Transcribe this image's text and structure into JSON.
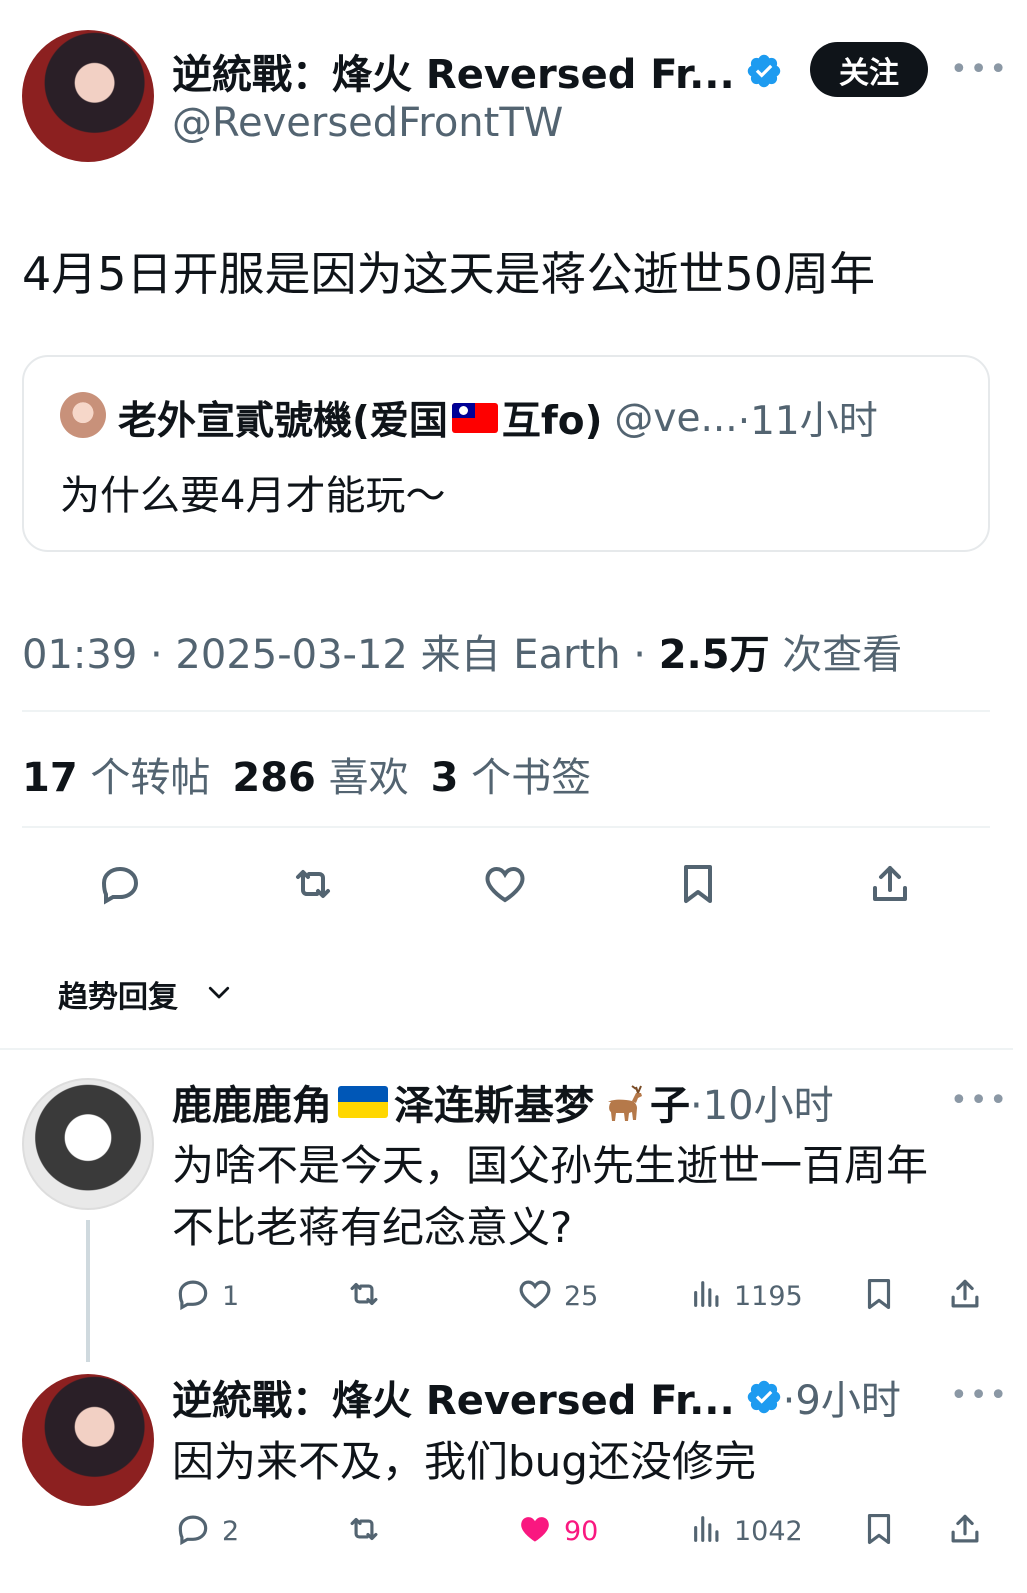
{
  "main_post": {
    "author_name": "逆統戰：烽火 Reversed Fr...",
    "author_handle": "@ReversedFrontTW",
    "follow_label": "关注",
    "text": "4月5日开服是因为这天是蒋公逝世50周年",
    "quote": {
      "author_name_part1": "老外宣貳號機(爱国",
      "author_name_part2": "互fo)",
      "author_handle": "@ve...",
      "time": "·11小时",
      "text": "为什么要4月才能玩～"
    },
    "meta_time": "01:39 · 2025-03-12 来自 Earth · ",
    "meta_views_num": "2.5万",
    "meta_views_label": " 次查看",
    "stats": [
      {
        "num": "17",
        "label": "个转帖"
      },
      {
        "num": "286",
        "label": "喜欢"
      },
      {
        "num": "3",
        "label": "个书签"
      }
    ]
  },
  "replies_sort": {
    "label": "趋势回复"
  },
  "replies": [
    {
      "author_name_part1": "鹿鹿鹿角",
      "author_name_part2": "泽连斯基梦",
      "author_name_part3": "子",
      "time": "·10小时",
      "text_line1": "为啥不是今天，国父孙先生逝世一百周年",
      "text_line2": "不比老蒋有纪念意义?",
      "reply_count": "1",
      "retweet_count": "",
      "like_count": "25",
      "view_count": "1195",
      "liked": false
    },
    {
      "author_name": "逆統戰：烽火 Reversed Fr...",
      "time": "·9小时",
      "text": "因为来不及，我们bug还没修完",
      "reply_count": "2",
      "retweet_count": "",
      "like_count": "90",
      "view_count": "1042",
      "liked": true
    }
  ],
  "colors": {
    "verified_blue": "#1d9bf0",
    "like_pink": "#f91880",
    "text_primary": "#0f1419",
    "text_muted": "#536471"
  },
  "icons": [
    "verified-badge-icon",
    "more-icon",
    "reply-icon",
    "retweet-icon",
    "like-icon",
    "bookmark-icon",
    "share-icon",
    "views-icon",
    "chevron-down-icon",
    "taiwan-flag-icon",
    "ukraine-flag-icon",
    "deer-icon"
  ]
}
